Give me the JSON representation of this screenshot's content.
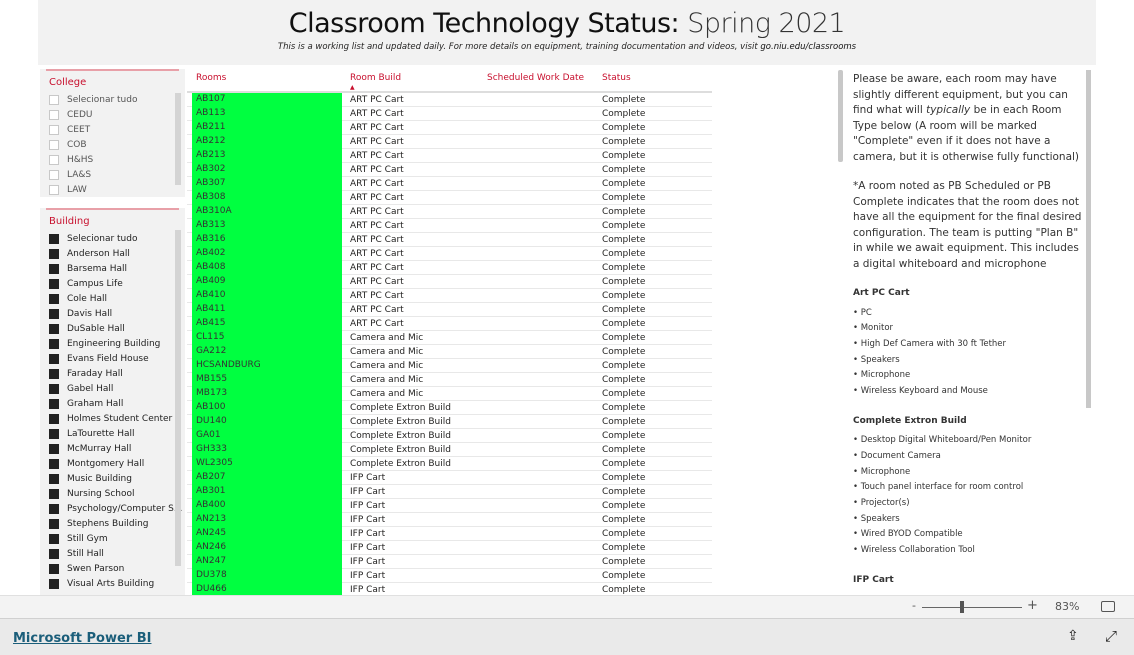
{
  "header": {
    "title": "Classroom Technology Status:",
    "title_suffix": "Spring 2021",
    "subtitle": "This is a working list and updated daily. For more details on equipment, training documentation and videos, visit ",
    "link": "go.niu.edu/classrooms"
  },
  "college": {
    "label": "College",
    "items": [
      "Selecionar tudo",
      "CEDU",
      "CEET",
      "COB",
      "H&HS",
      "LA&S",
      "LAW"
    ]
  },
  "building": {
    "label": "Building",
    "items": [
      "Selecionar tudo",
      "Anderson Hall",
      "Barsema Hall",
      "Campus Life",
      "Cole Hall",
      "Davis Hall",
      "DuSable Hall",
      "Engineering Building",
      "Evans Field House",
      "Faraday Hall",
      "Gabel Hall",
      "Graham Hall",
      "Holmes Student Center",
      "LaTourette Hall",
      "McMurray Hall",
      "Montgomery Hall",
      "Music Building",
      "Nursing School",
      "Psychology/Computer S...",
      "Stephens Building",
      "Still Gym",
      "Still Hall",
      "Swen Parson",
      "Visual Arts Building"
    ]
  },
  "table": {
    "columns": [
      "Rooms",
      "Room Build",
      "Scheduled Work Date",
      "Status"
    ],
    "highlight_color": "#00ff40",
    "rows": [
      [
        "AB107",
        "ART PC Cart",
        "",
        "Complete"
      ],
      [
        "AB113",
        "ART PC Cart",
        "",
        "Complete"
      ],
      [
        "AB211",
        "ART PC Cart",
        "",
        "Complete"
      ],
      [
        "AB212",
        "ART PC Cart",
        "",
        "Complete"
      ],
      [
        "AB213",
        "ART PC Cart",
        "",
        "Complete"
      ],
      [
        "AB302",
        "ART PC Cart",
        "",
        "Complete"
      ],
      [
        "AB307",
        "ART PC Cart",
        "",
        "Complete"
      ],
      [
        "AB308",
        "ART PC Cart",
        "",
        "Complete"
      ],
      [
        "AB310A",
        "ART PC Cart",
        "",
        "Complete"
      ],
      [
        "AB313",
        "ART PC Cart",
        "",
        "Complete"
      ],
      [
        "AB316",
        "ART PC Cart",
        "",
        "Complete"
      ],
      [
        "AB402",
        "ART PC Cart",
        "",
        "Complete"
      ],
      [
        "AB408",
        "ART PC Cart",
        "",
        "Complete"
      ],
      [
        "AB409",
        "ART PC Cart",
        "",
        "Complete"
      ],
      [
        "AB410",
        "ART PC Cart",
        "",
        "Complete"
      ],
      [
        "AB411",
        "ART PC Cart",
        "",
        "Complete"
      ],
      [
        "AB415",
        "ART PC Cart",
        "",
        "Complete"
      ],
      [
        "CL115",
        "Camera and Mic",
        "",
        "Complete"
      ],
      [
        "GA212",
        "Camera and Mic",
        "",
        "Complete"
      ],
      [
        "HCSANDBURG",
        "Camera and Mic",
        "",
        "Complete"
      ],
      [
        "MB155",
        "Camera and Mic",
        "",
        "Complete"
      ],
      [
        "MB173",
        "Camera and Mic",
        "",
        "Complete"
      ],
      [
        "AB100",
        "Complete Extron Build",
        "",
        "Complete"
      ],
      [
        "DU140",
        "Complete Extron Build",
        "",
        "Complete"
      ],
      [
        "GA01",
        "Complete Extron Build",
        "",
        "Complete"
      ],
      [
        "GH333",
        "Complete Extron Build",
        "",
        "Complete"
      ],
      [
        "WL2305",
        "Complete Extron Build",
        "",
        "Complete"
      ],
      [
        "AB207",
        "IFP Cart",
        "",
        "Complete"
      ],
      [
        "AB301",
        "IFP Cart",
        "",
        "Complete"
      ],
      [
        "AB400",
        "IFP Cart",
        "",
        "Complete"
      ],
      [
        "AN213",
        "IFP Cart",
        "",
        "Complete"
      ],
      [
        "AN245",
        "IFP Cart",
        "",
        "Complete"
      ],
      [
        "AN246",
        "IFP Cart",
        "",
        "Complete"
      ],
      [
        "AN247",
        "IFP Cart",
        "",
        "Complete"
      ],
      [
        "DU378",
        "IFP Cart",
        "",
        "Complete"
      ],
      [
        "DU466",
        "IFP Cart",
        "",
        "Complete"
      ]
    ]
  },
  "info": {
    "p1a": "Please be aware, each room may have slightly different equipment, but you can find what will ",
    "p1em": "typically",
    "p1b": " be in each Room Type below (A room will be marked \"Complete\" even if it does not have a camera, but it is otherwise fully functional)",
    "p2": "*A room noted as PB Scheduled or PB Complete indicates that the room does not have all the equipment for the final desired configuration. The team is putting \"Plan B\" in while we await equipment. This includes a digital whiteboard and microphone",
    "sections": [
      {
        "title": "Art PC Cart",
        "items": [
          "PC",
          "Monitor",
          "High Def Camera with 30 ft Tether",
          "Speakers",
          "Microphone",
          "Wireless Keyboard and Mouse"
        ]
      },
      {
        "title": "Complete Extron Build",
        "items": [
          "Desktop Digital Whiteboard/Pen Monitor",
          "Document Camera",
          "Microphone",
          "Touch panel interface for room control",
          "Projector(s)",
          "Speakers",
          "Wired BYOD Compatible",
          "Wireless Collaboration Tool"
        ]
      },
      {
        "title": "IFP Cart",
        "items": []
      }
    ]
  },
  "zoom": {
    "minus": "-",
    "plus": "+",
    "level": "83%",
    "value": 83
  },
  "footer": {
    "brand": "Microsoft Power BI"
  }
}
